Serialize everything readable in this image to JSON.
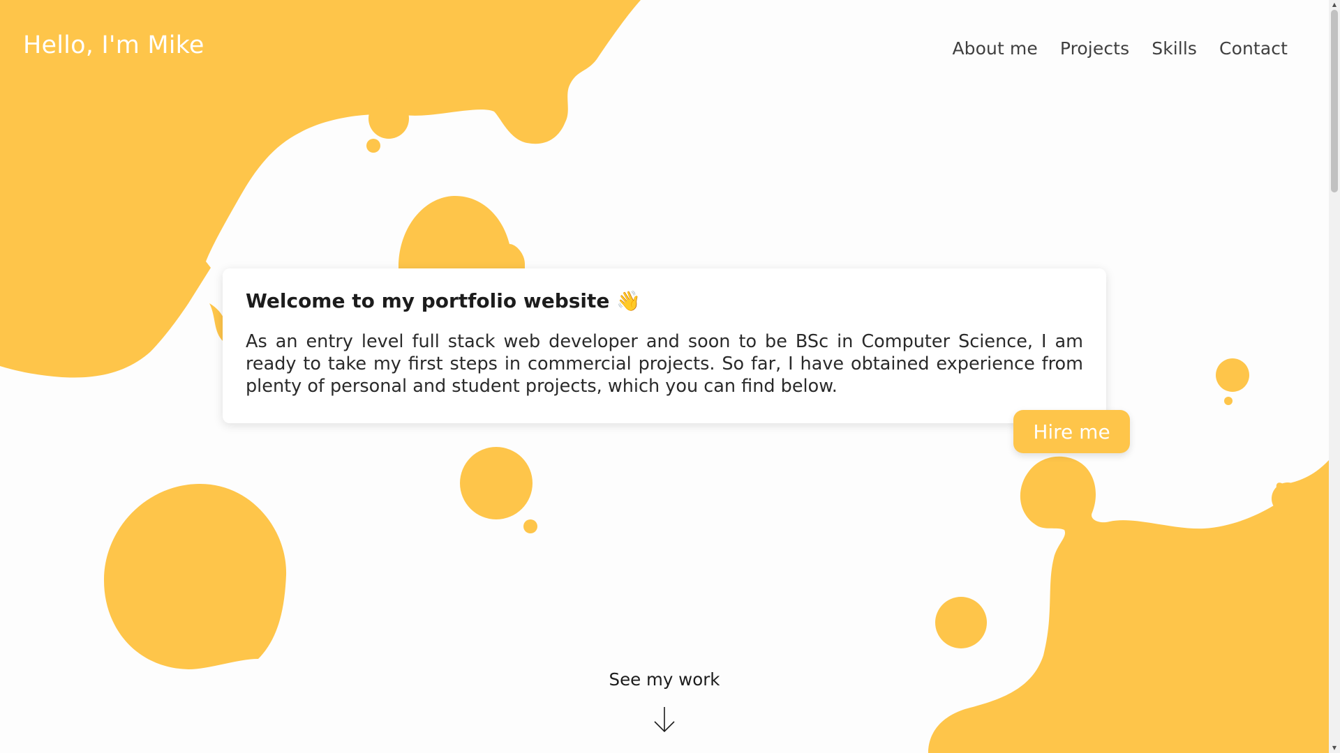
{
  "header": {
    "logo_text": "Hello, I'm Mike"
  },
  "nav": {
    "items": [
      {
        "label": "About me"
      },
      {
        "label": "Projects"
      },
      {
        "label": "Skills"
      },
      {
        "label": "Contact"
      }
    ]
  },
  "intro_card": {
    "title": "Welcome to my portfolio website 👋",
    "body": "As an entry level full stack web developer and soon to be BSc in Computer Science, I am ready to take my first steps in commercial projects. So far, I have obtained experience from plenty of personal and student projects, which you can find below."
  },
  "hire_button": {
    "label": "Hire me"
  },
  "see_work": {
    "label": "See my work",
    "icon": "arrow-down-icon"
  },
  "colors": {
    "accent": "#fec54a",
    "background": "#fdfdfd",
    "text": "#1c1c1c"
  }
}
